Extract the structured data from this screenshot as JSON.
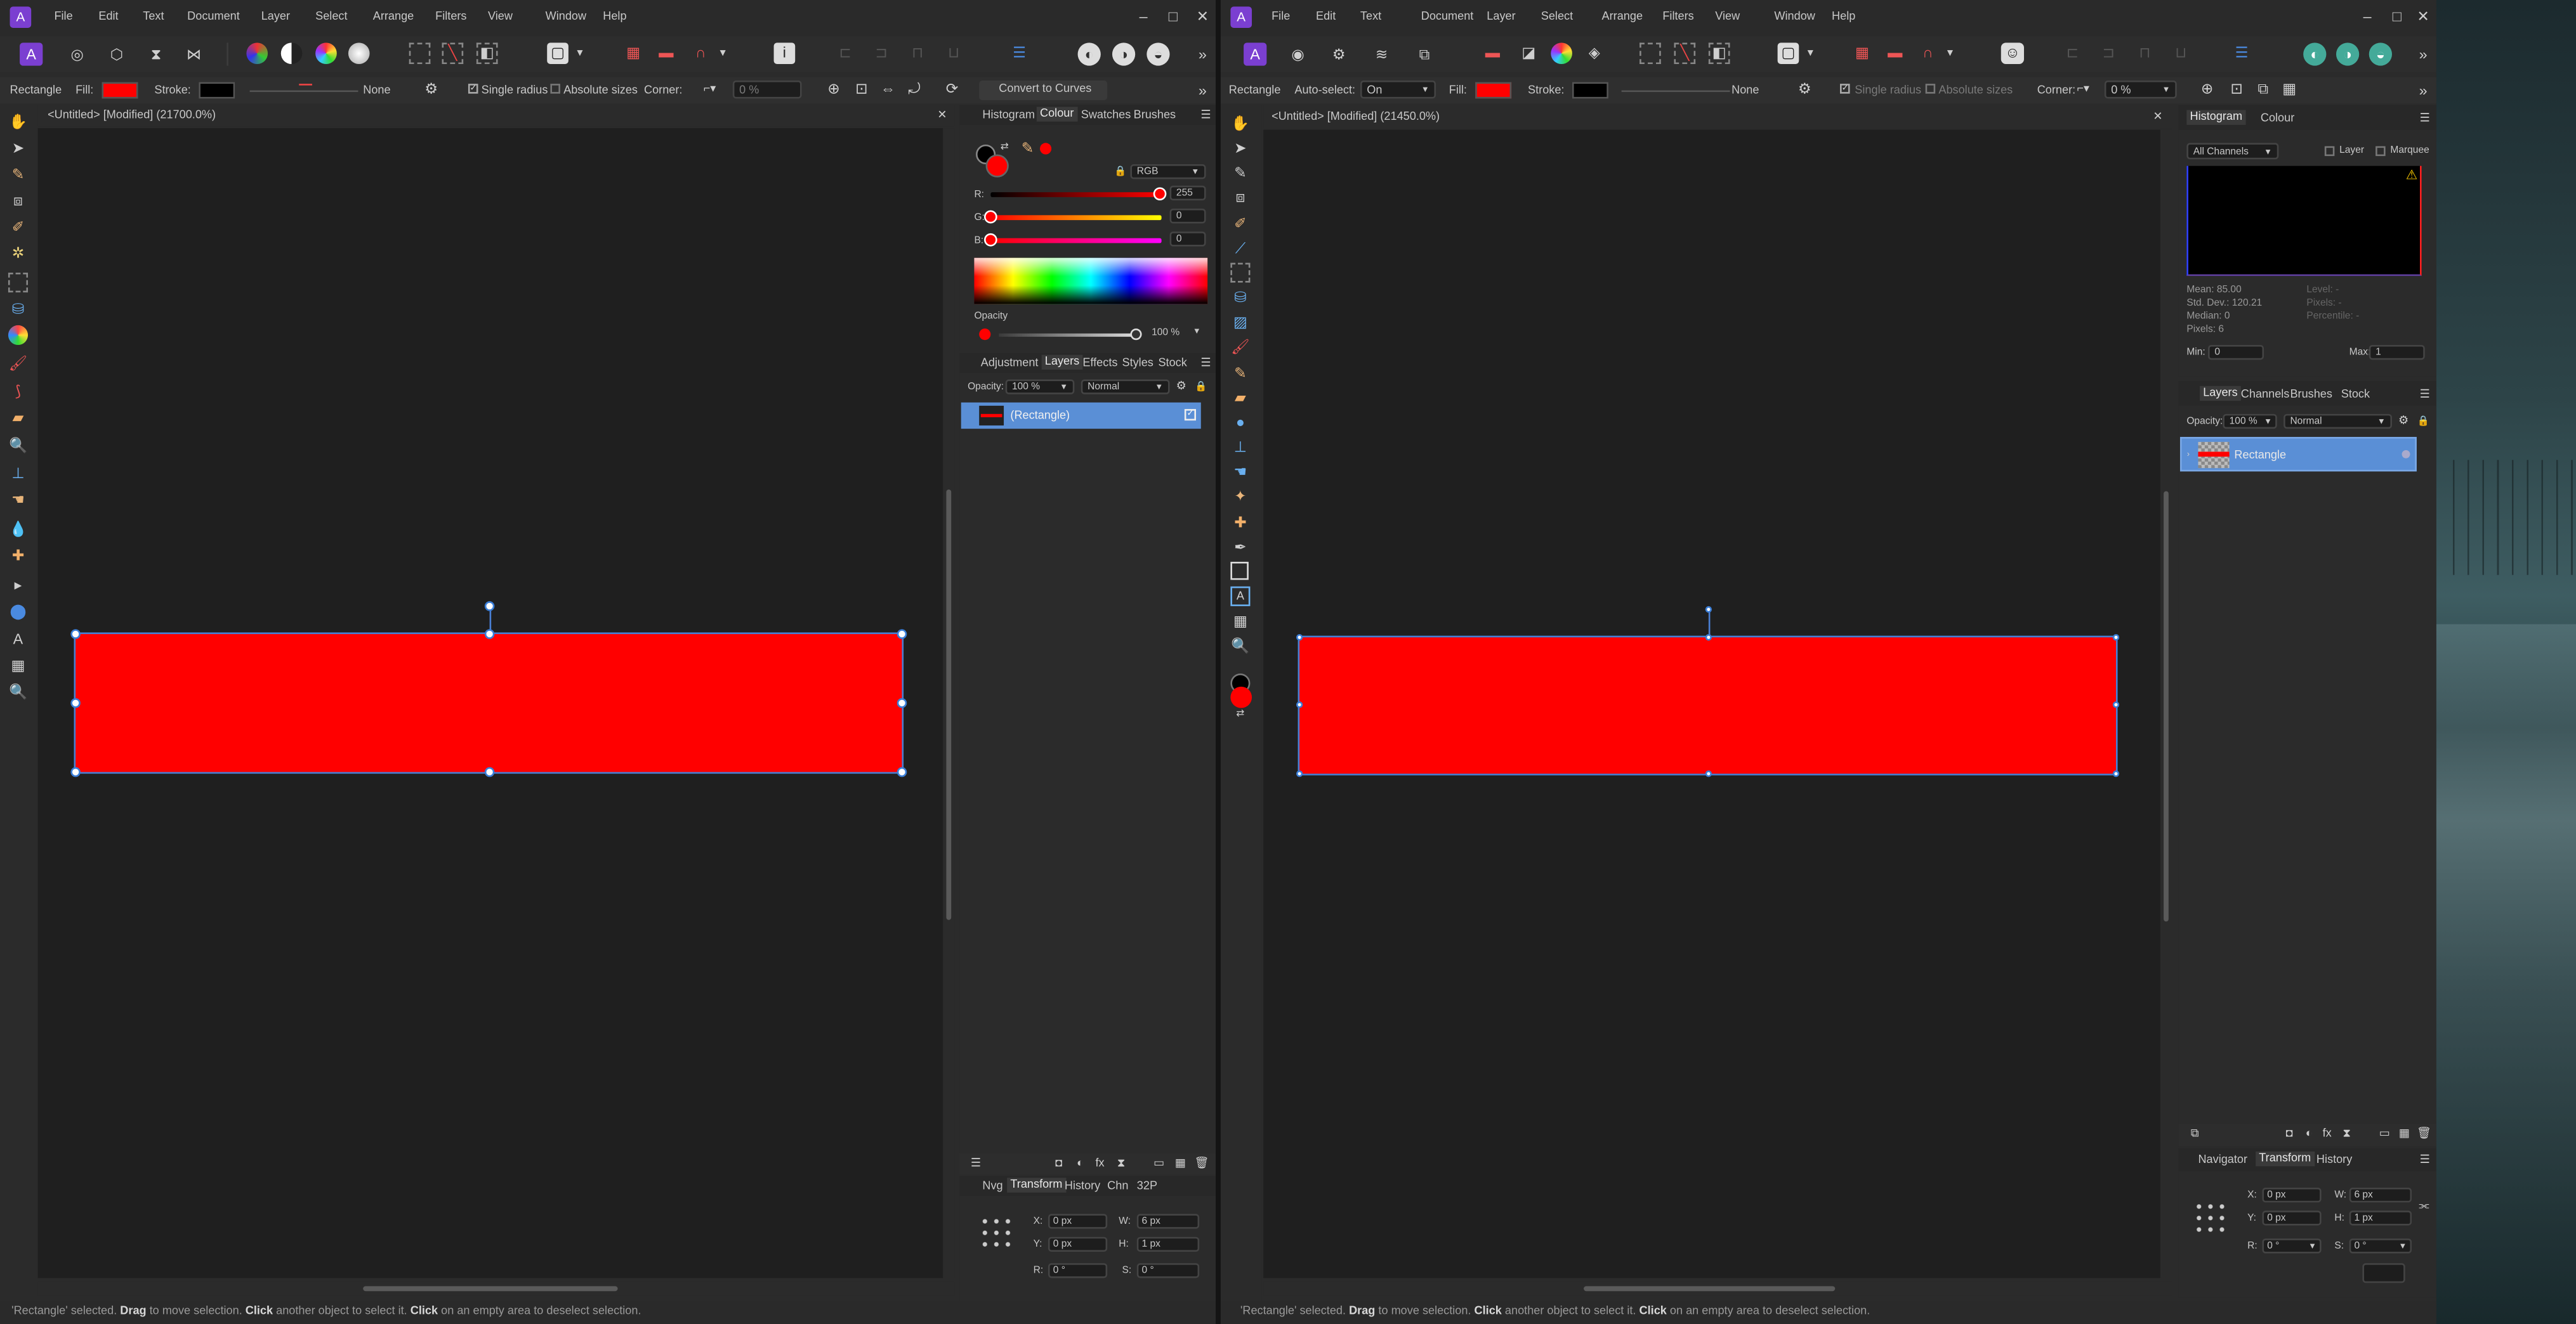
{
  "left": {
    "menu": [
      "File",
      "Edit",
      "Text",
      "Document",
      "Layer",
      "Select",
      "Arrange",
      "Filters",
      "View",
      "Window",
      "Help"
    ],
    "context": {
      "tool": "Rectangle",
      "fill_label": "Fill:",
      "stroke_label": "Stroke:",
      "stroke_style": "None",
      "single_radius": "Single radius",
      "absolute_sizes": "Absolute sizes",
      "corner_label": "Corner:",
      "corner_value": "0 %",
      "convert_button": "Convert to Curves"
    },
    "doc_tab": "<Untitled> [Modified] (21700.0%)",
    "colour_panel": {
      "tabs": [
        "Histogram",
        "Colour",
        "Swatches",
        "Brushes"
      ],
      "active": "Colour",
      "model": "RGB",
      "r_label": "R:",
      "g_label": "G:",
      "b_label": "B:",
      "r": "255",
      "g": "0",
      "b": "0",
      "opacity_label": "Opacity",
      "opacity": "100 %"
    },
    "layers_panel": {
      "tabs": [
        "Adjustment",
        "Layers",
        "Effects",
        "Styles",
        "Stock"
      ],
      "active": "Layers",
      "opacity_label": "Opacity:",
      "opacity": "100 %",
      "blend": "Normal",
      "layer_name": "(Rectangle)"
    },
    "transform_panel": {
      "tabs": [
        "Nvg",
        "Transform",
        "History",
        "Chn",
        "32P"
      ],
      "active": "Transform",
      "x_label": "X:",
      "x": "0 px",
      "y_label": "Y:",
      "y": "0 px",
      "w_label": "W:",
      "w": "6 px",
      "h_label": "H:",
      "h": "1 px",
      "r_label": "R:",
      "r": "0 °",
      "s_label": "S:",
      "s": "0 °"
    },
    "status": [
      {
        "t": "'Rectangle' selected. ",
        "b": false
      },
      {
        "t": "Drag",
        "b": true
      },
      {
        "t": " to move selection. ",
        "b": false
      },
      {
        "t": "Click",
        "b": true
      },
      {
        "t": " another object to select it. ",
        "b": false
      },
      {
        "t": "Click",
        "b": true
      },
      {
        "t": " on an empty area to deselect selection.",
        "b": false
      }
    ]
  },
  "right": {
    "menu": [
      "File",
      "Edit",
      "Text",
      "Document",
      "Layer",
      "Select",
      "Arrange",
      "Filters",
      "View",
      "Window",
      "Help"
    ],
    "context": {
      "tool": "Rectangle",
      "autoselect_label": "Auto-select:",
      "autoselect_value": "On",
      "fill_label": "Fill:",
      "stroke_label": "Stroke:",
      "stroke_style": "None",
      "single_radius": "Single radius",
      "absolute_sizes": "Absolute sizes",
      "corner_label": "Corner:",
      "corner_value": "0 %"
    },
    "doc_tab": "<Untitled> [Modified] (21450.0%)",
    "histogram_panel": {
      "tabs": [
        "Histogram",
        "Colour"
      ],
      "active": "Histogram",
      "channels": "All Channels",
      "layer": "Layer",
      "marquee": "Marquee",
      "mean": "Mean: 85.00",
      "std": "Std. Dev.: 120.21",
      "median": "Median: 0",
      "pixels": "Pixels: 6",
      "level": "Level: -",
      "pixels2": "Pixels: -",
      "percentile": "Percentile: -",
      "min_label": "Min:",
      "min": "0",
      "max_label": "Max:",
      "max": "1"
    },
    "layers_panel": {
      "tabs": [
        "Layers",
        "Channels",
        "Brushes",
        "Stock"
      ],
      "active": "Layers",
      "opacity_label": "Opacity:",
      "opacity": "100 %",
      "blend": "Normal",
      "layer_name": "Rectangle"
    },
    "transform_panel": {
      "tabs": [
        "Navigator",
        "Transform",
        "History"
      ],
      "active": "Transform",
      "x_label": "X:",
      "x": "0 px",
      "y_label": "Y:",
      "y": "0 px",
      "w_label": "W:",
      "w": "6 px",
      "h_label": "H:",
      "h": "1 px",
      "r_label": "R:",
      "r": "0 °",
      "s_label": "S:",
      "s": "0 °"
    },
    "status": [
      {
        "t": "'Rectangle' selected. ",
        "b": false
      },
      {
        "t": "Drag",
        "b": true
      },
      {
        "t": " to move selection. ",
        "b": false
      },
      {
        "t": "Click",
        "b": true
      },
      {
        "t": " another object to select it. ",
        "b": false
      },
      {
        "t": "Click",
        "b": true
      },
      {
        "t": " on an empty area to deselect selection.",
        "b": false
      }
    ]
  },
  "colors": {
    "fill": "#ff0000",
    "stroke": "#000000",
    "accent": "#5a8fd6",
    "panel": "#2b2b2b",
    "canvas": "#1f1f1f"
  }
}
